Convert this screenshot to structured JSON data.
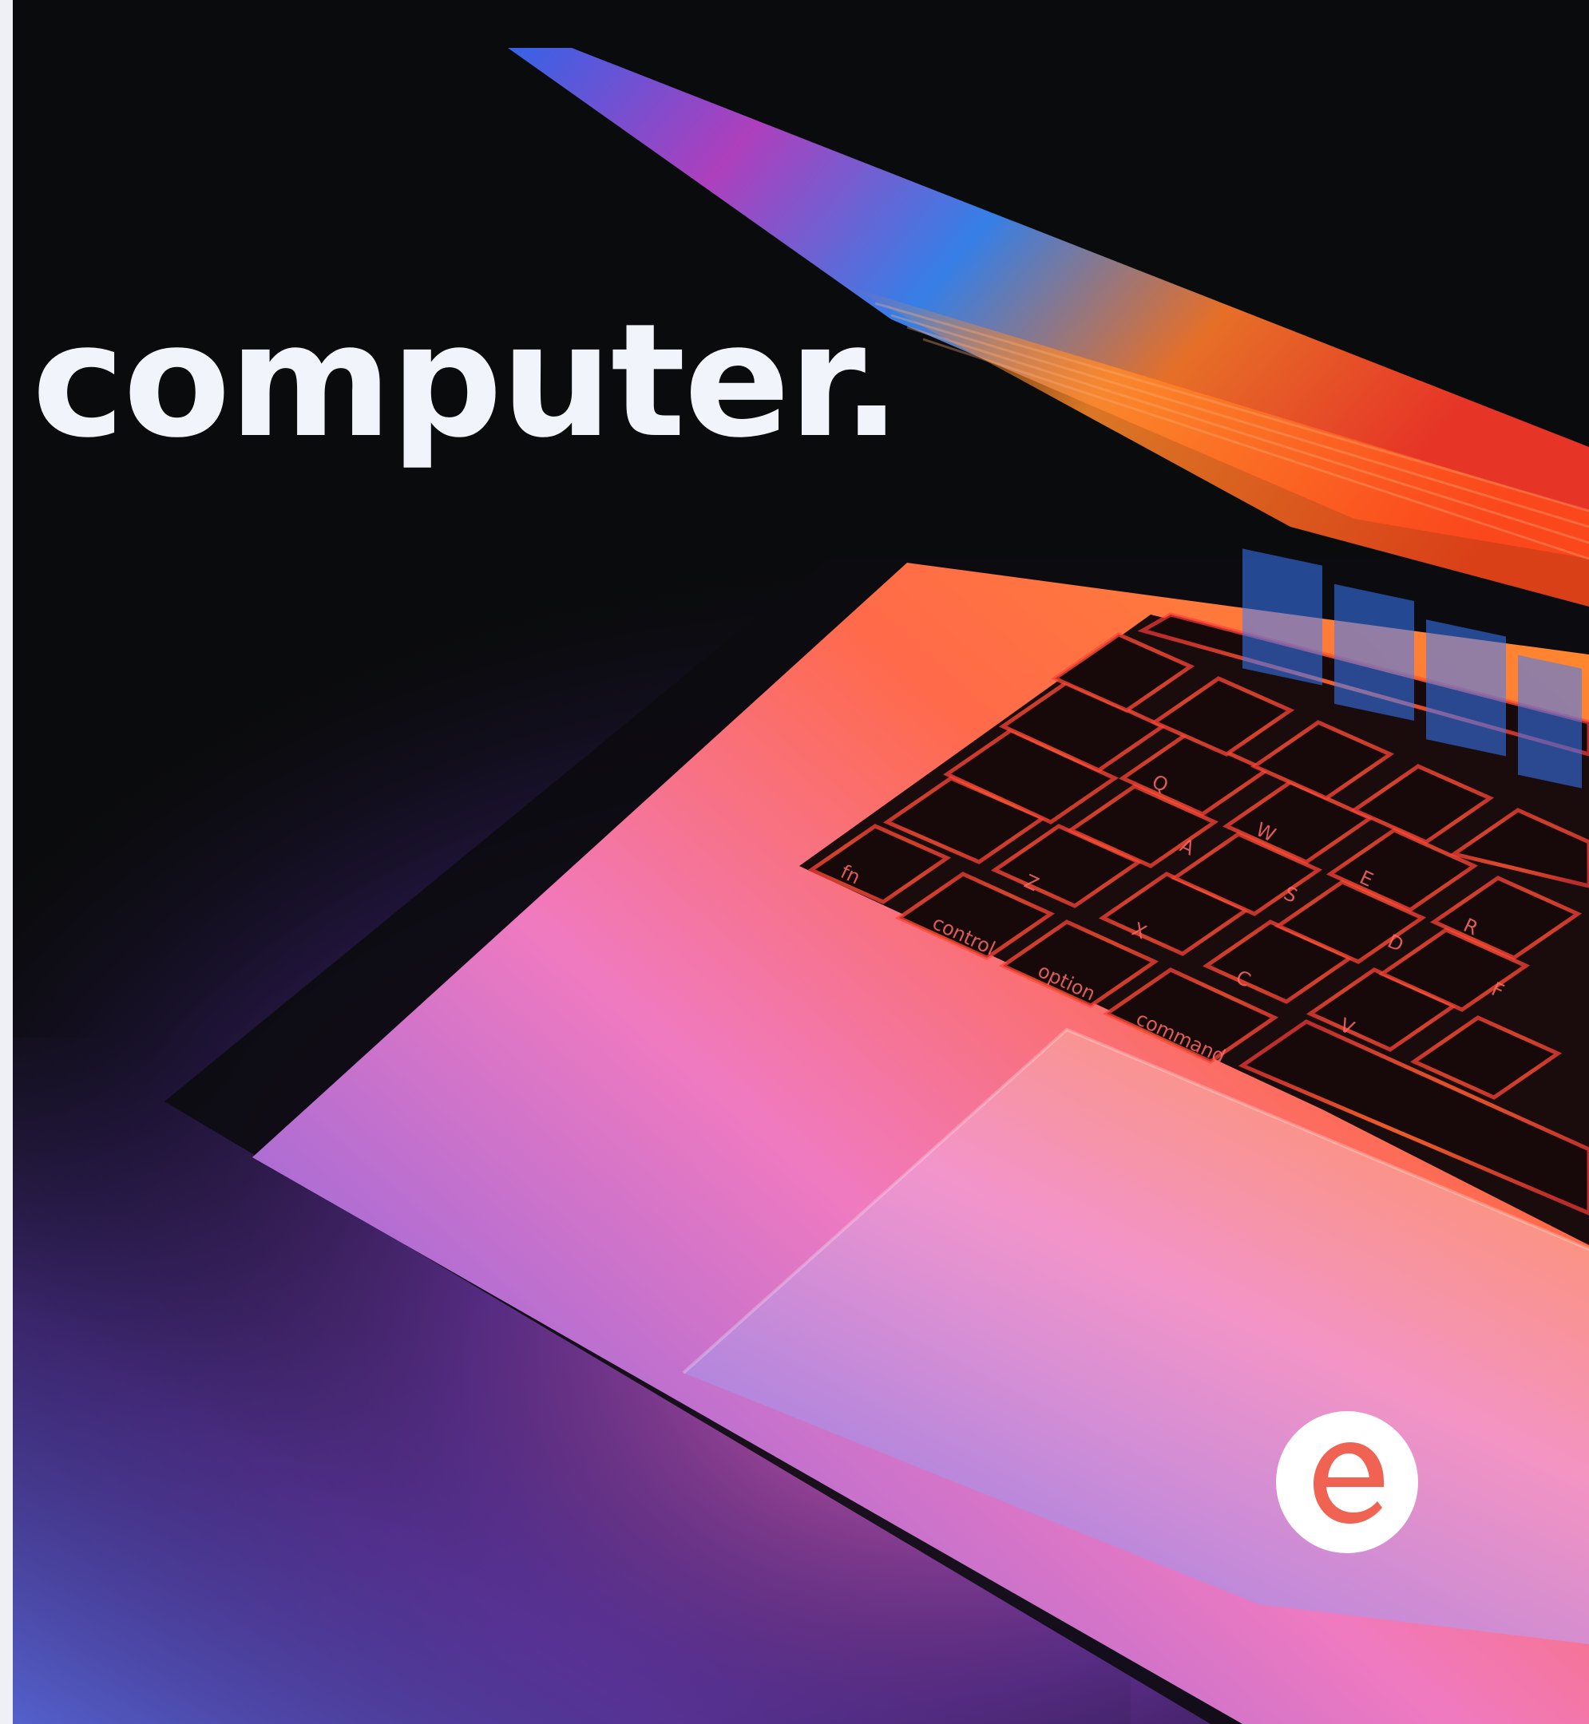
{
  "headline": {
    "text": "computer."
  },
  "logo": {
    "icon": "letter-e-logo-icon",
    "color": "#f06352",
    "background": "#ffffff"
  },
  "photo": {
    "subject": "laptop-keyboard-photo",
    "keys": [
      "fn",
      "control",
      "option",
      "command",
      "Q",
      "W",
      "E",
      "R",
      "A",
      "S",
      "D",
      "F",
      "Z",
      "X",
      "C",
      "V"
    ]
  },
  "colors": {
    "background": "#0a0b0c",
    "headline": "#f1f4fa",
    "glow_orange": "#ff7a2e",
    "glow_pink": "#f06aa8",
    "glow_purple": "#8a4fd0",
    "glow_blue": "#3a6fe0"
  }
}
